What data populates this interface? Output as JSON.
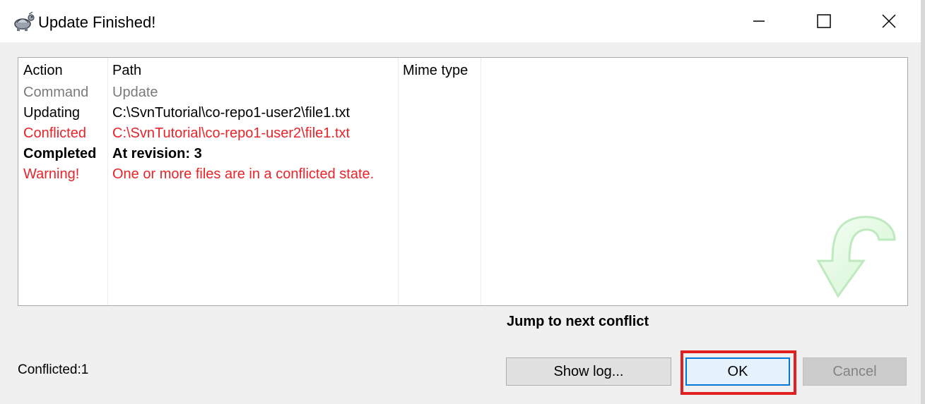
{
  "window": {
    "title": "Update Finished!",
    "icon": "tortoise-svn-icon",
    "controls": {
      "minimize": "minimize-icon",
      "maximize": "maximize-icon",
      "close": "close-icon"
    }
  },
  "list": {
    "columns": [
      "Action",
      "Path",
      "Mime type"
    ],
    "rows": [
      {
        "action": "Command",
        "path": "Update",
        "style": "gray"
      },
      {
        "action": "Updating",
        "path": "C:\\SvnTutorial\\co-repo1-user2\\file1.txt",
        "style": "black"
      },
      {
        "action": "Conflicted",
        "path": "C:\\SvnTutorial\\co-repo1-user2\\file1.txt",
        "style": "red"
      },
      {
        "action": "Completed",
        "path": "At revision: 3",
        "style": "bold"
      },
      {
        "action": "Warning!",
        "path": "One or more files are in a conflicted state.",
        "style": "red"
      }
    ]
  },
  "jump_link": "Jump to next conflict",
  "status": "Conflicted:1",
  "buttons": {
    "show_log": "Show log...",
    "ok": "OK",
    "cancel": "Cancel"
  },
  "colors": {
    "conflict_red": "#e8242a",
    "gray_text": "#7a7a7a",
    "focus_blue": "#0078d7",
    "highlight_red": "#e02020"
  }
}
